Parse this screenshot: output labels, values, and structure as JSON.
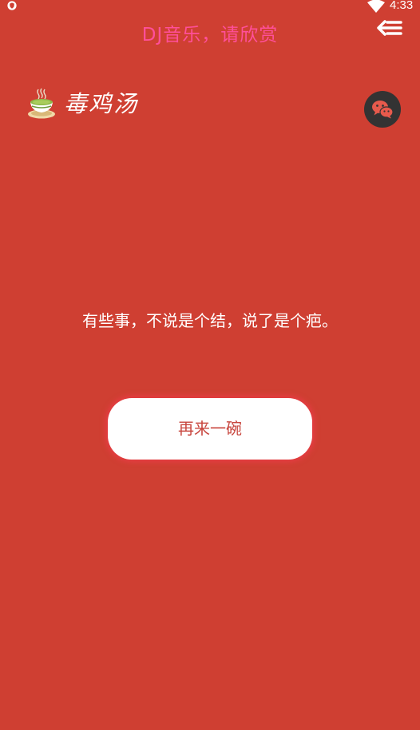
{
  "status_bar": {
    "time": "4:33",
    "left_icon": "shield-icon",
    "signal_icon": "wifi-icon"
  },
  "header": {
    "title": "DJ音乐，请欣赏",
    "title_color": "#ff4f9a",
    "menu_icon": "back-menu-icon"
  },
  "brand": {
    "icon": "teacup-icon",
    "name": "毒鸡汤"
  },
  "share": {
    "icon": "wechat-icon"
  },
  "content": {
    "quote": "有些事，不说是个结，说了是个疤。",
    "button_label": "再来一碗"
  },
  "colors": {
    "background": "#cf3f32",
    "button_text": "#c8463e",
    "share_bg": "#333333"
  }
}
